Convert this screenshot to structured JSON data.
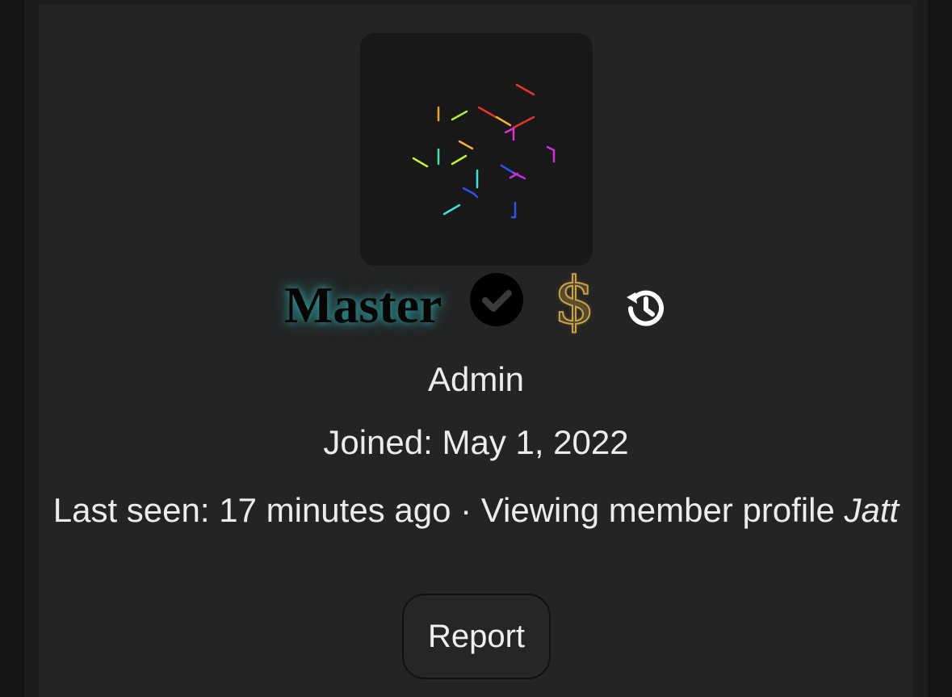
{
  "profile": {
    "username": "Master",
    "role": "Admin",
    "joined_label": "Joined:",
    "joined_date": "May 1, 2022",
    "last_seen_label": "Last seen:",
    "last_seen_value": "17 minutes ago",
    "separator": " · ",
    "activity": "Viewing member profile",
    "activity_target": "Jatt",
    "badges": [
      "verified-check-icon",
      "dollar-icon",
      "history-icon"
    ]
  },
  "actions": {
    "report_label": "Report"
  },
  "colors": {
    "page_bg": "#141414",
    "card_bg": "#242424",
    "avatar_bg": "#181818",
    "username_glow": "#3cc8c8",
    "dollar_gold": "#c9a44a",
    "text": "#ececec"
  }
}
